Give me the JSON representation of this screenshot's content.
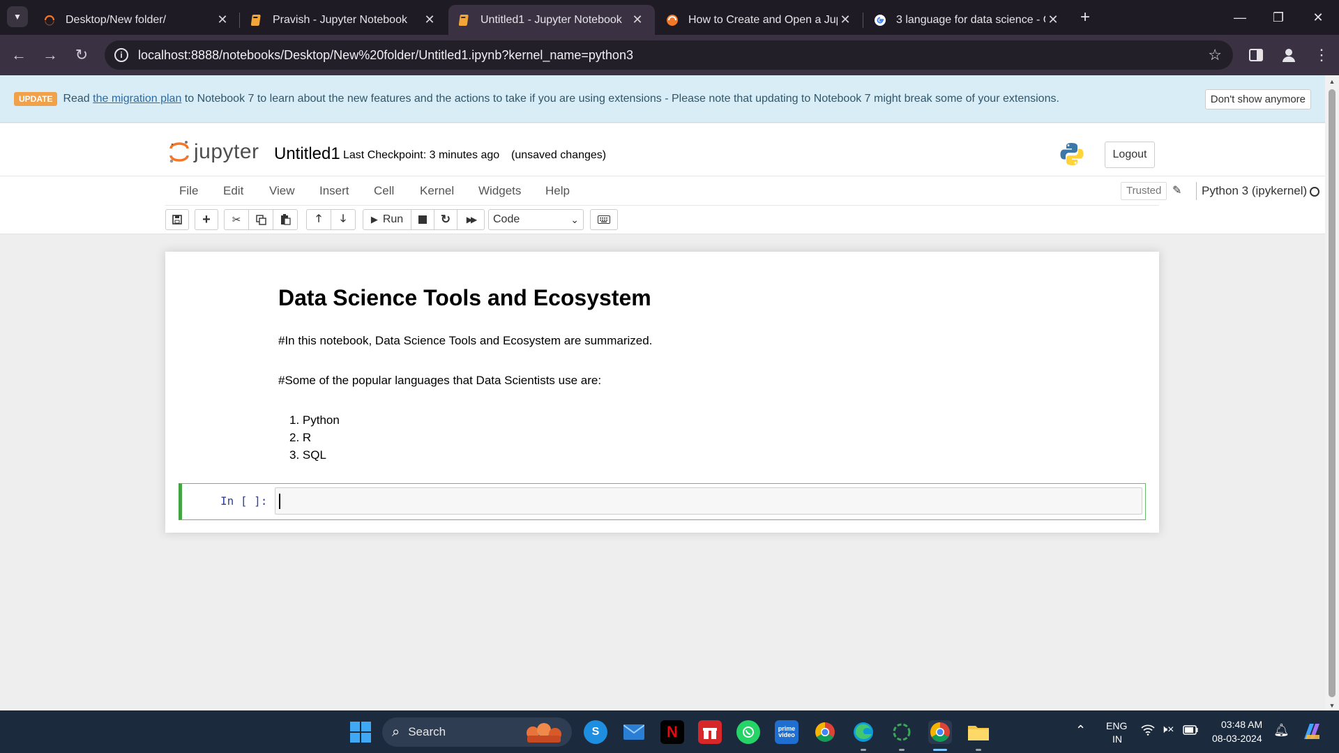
{
  "browser": {
    "tabs": [
      {
        "title": "Desktop/New folder/",
        "icon": "jupyter-loading-icon",
        "active": false
      },
      {
        "title": "Pravish - Jupyter Notebook",
        "icon": "notebook-icon",
        "active": false
      },
      {
        "title": "Untitled1 - Jupyter Notebook",
        "icon": "notebook-icon",
        "active": true
      },
      {
        "title": "How to Create and Open a Jupy",
        "icon": "jupyter-icon",
        "active": false
      },
      {
        "title": "3 language for data science - G",
        "icon": "google-icon",
        "active": false
      }
    ],
    "url": "localhost:8888/notebooks/Desktop/New%20folder/Untitled1.ipynb?kernel_name=python3"
  },
  "banner": {
    "badge": "UPDATE",
    "text_before": "Read ",
    "link": "the migration plan",
    "text_after": " to Notebook 7 to learn about the new features and the actions to take if you are using extensions - Please note that updating to Notebook 7 might break some of your extensions.",
    "dismiss": "Don't show anymore"
  },
  "header": {
    "logo_text": "jupyter",
    "notebook_name": "Untitled1",
    "checkpoint": "Last Checkpoint: 3 minutes ago",
    "status": "(unsaved changes)",
    "logout": "Logout"
  },
  "menu": {
    "items": [
      "File",
      "Edit",
      "View",
      "Insert",
      "Cell",
      "Kernel",
      "Widgets",
      "Help"
    ],
    "trusted": "Trusted",
    "kernel": "Python 3 (ipykernel)"
  },
  "toolbar": {
    "run": "Run",
    "cell_type": "Code"
  },
  "cells": {
    "markdown": {
      "heading": "Data Science Tools and Ecosystem",
      "p1": "#In this notebook, Data Science Tools and Ecosystem are summarized.",
      "p2": "#Some of the popular languages that Data Scientists use are:",
      "list": [
        "1. Python",
        "2. R",
        "3. SQL"
      ]
    },
    "code": {
      "prompt": "In [ ]:"
    }
  },
  "taskbar": {
    "search": "Search",
    "lang": "ENG",
    "region": "IN",
    "time": "03:48 AM",
    "date": "08-03-2024",
    "accent": "#3fa9f5"
  }
}
